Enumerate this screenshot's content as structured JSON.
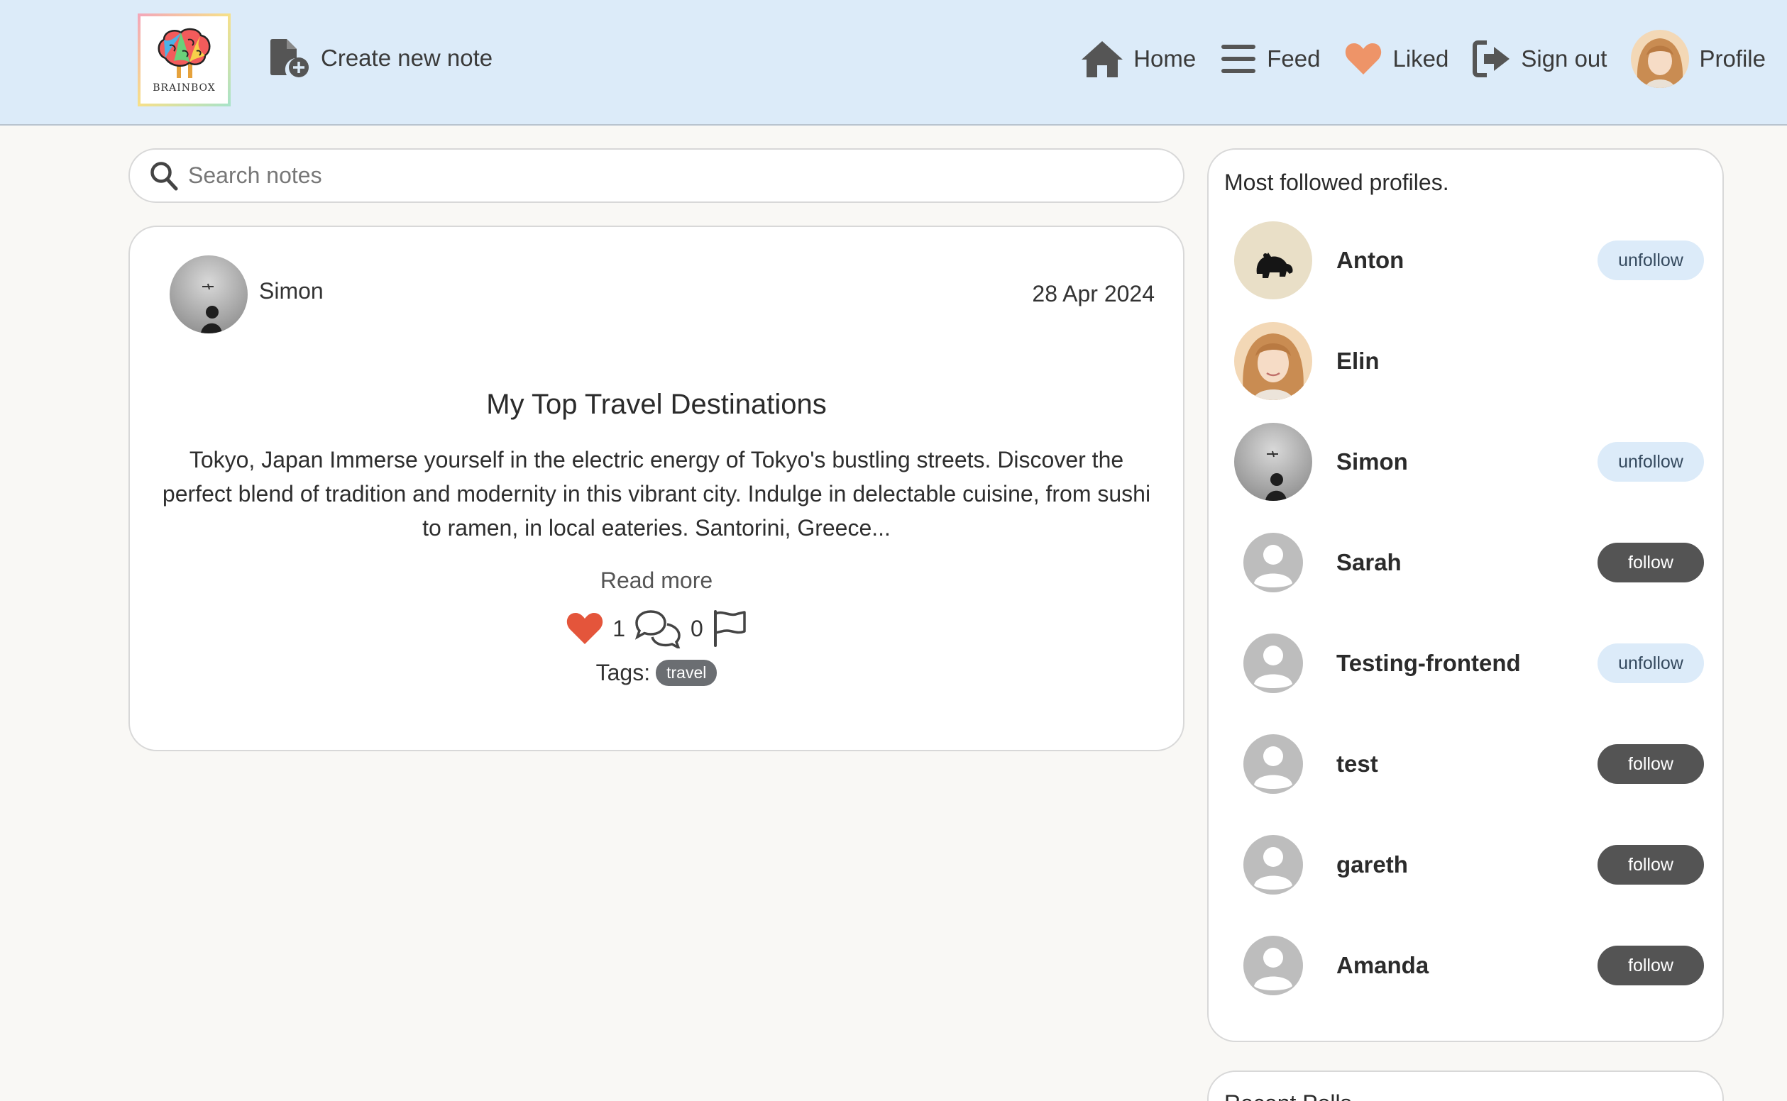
{
  "nav": {
    "logo_text": "BRAINBOX",
    "create_label": "Create new note",
    "items": [
      {
        "label": "Home",
        "icon": "home-icon"
      },
      {
        "label": "Feed",
        "icon": "bars-icon"
      },
      {
        "label": "Liked",
        "icon": "heart-icon"
      },
      {
        "label": "Sign out",
        "icon": "sign-out-icon"
      },
      {
        "label": "Profile",
        "icon": "avatar"
      }
    ]
  },
  "search": {
    "placeholder": "Search notes"
  },
  "note": {
    "author": "Simon",
    "date": "28 Apr 2024",
    "title": "My Top Travel Destinations",
    "body": "Tokyo, Japan Immerse yourself in the electric energy of Tokyo's bustling streets. Discover the perfect blend of tradition and modernity in this vibrant city. Indulge in delectable cuisine, from sushi to ramen, in local eateries. Santorini, Greece...",
    "read_more": "Read more",
    "likes": "1",
    "comments": "0",
    "tags_label": "Tags:",
    "tags": [
      "travel"
    ]
  },
  "sidebar": {
    "title": "Most followed profiles.",
    "profiles": [
      {
        "name": "Anton",
        "button": "unfollow"
      },
      {
        "name": "Elin",
        "button": ""
      },
      {
        "name": "Simon",
        "button": "unfollow"
      },
      {
        "name": "Sarah",
        "button": "follow"
      },
      {
        "name": "Testing-frontend",
        "button": "unfollow"
      },
      {
        "name": "test",
        "button": "follow"
      },
      {
        "name": "gareth",
        "button": "follow"
      },
      {
        "name": "Amanda",
        "button": "follow"
      }
    ]
  },
  "recent": {
    "title": "Recent Polls"
  },
  "colors": {
    "navbar_bg": "#dcebf9",
    "like_heart": "#e4553b",
    "nav_heart": "#ee9468",
    "follow_btn": "#545454",
    "unfollow_btn": "#dcebf9",
    "tag_pill": "#6b6e72"
  }
}
